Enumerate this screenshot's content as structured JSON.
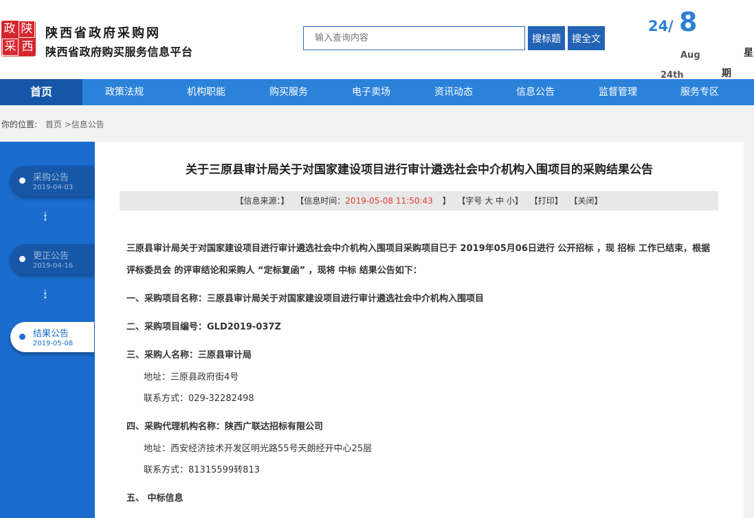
{
  "header": {
    "logo_chars": [
      "政",
      "陕",
      "采",
      "西"
    ],
    "site_title": "陕西省政府采购网",
    "site_subtitle": "陕西省政府购买服务信息平台",
    "search": {
      "placeholder": "输入查询内容",
      "btn_title": "搜标题",
      "btn_full": "搜全文"
    },
    "date": {
      "day": "24",
      "slash": "/",
      "month": "8",
      "mon_abbr": "Aug",
      "day_ord": "24th",
      "week1": "星",
      "week2": "期"
    }
  },
  "nav": [
    "首页",
    "政策法规",
    "机构职能",
    "购买服务",
    "电子卖场",
    "资讯动态",
    "信息公告",
    "监督管理",
    "服务专区"
  ],
  "breadcrumb": {
    "label": "你的位置:",
    "path": "首页 >信息公告"
  },
  "sidebar": {
    "steps": [
      {
        "label": "采购公告",
        "date": "2019-04-03",
        "active": false
      },
      {
        "label": "更正公告",
        "date": "2019-04-16",
        "active": false
      },
      {
        "label": "结果公告",
        "date": "2019-05-08",
        "active": true
      }
    ],
    "arrow": "↓"
  },
  "article": {
    "title": "关于三原县审计局关于对国家建设项目进行审计遴选社会中介机构入围项目的采购结果公告",
    "meta": {
      "source": "【信息来源：】",
      "time_label": "【信息时间：",
      "time_value": "2019-05-08 11:50:43",
      "time_end": "】",
      "font": "【字号 大 中 小】",
      "print": "【打印】",
      "close": "【关闭】"
    },
    "intro1": "三原县审计局关于对国家建设项目进行审计遴选社会中介机构入围项目采购项目已于 2019年05月06日进行 公开招标 ，现 招标 工作已结束，根据",
    "intro2": "评标委员会 的评审结论和采购人 “定标复函” ，现将 中标 结果公告如下：",
    "item1": "一、采购项目名称：三原县审计局关于对国家建设项目进行审计遴选社会中介机构入围项目",
    "item2": "二、采购项目编号：GLD2019-037Z",
    "item3": "三、采购人名称：三原县审计局",
    "item3_addr": "地址：三原县政府街4号",
    "item3_tel": "联系方式：029-32282498",
    "item4": "四、采购代理机构名称：陕西广联达招标有限公司",
    "item4_addr": "地址：西安经济技术开发区明光路55号天朗经开中心25层",
    "item4_tel": "联系方式：81315599转813",
    "item5": "五、 中标信息"
  }
}
